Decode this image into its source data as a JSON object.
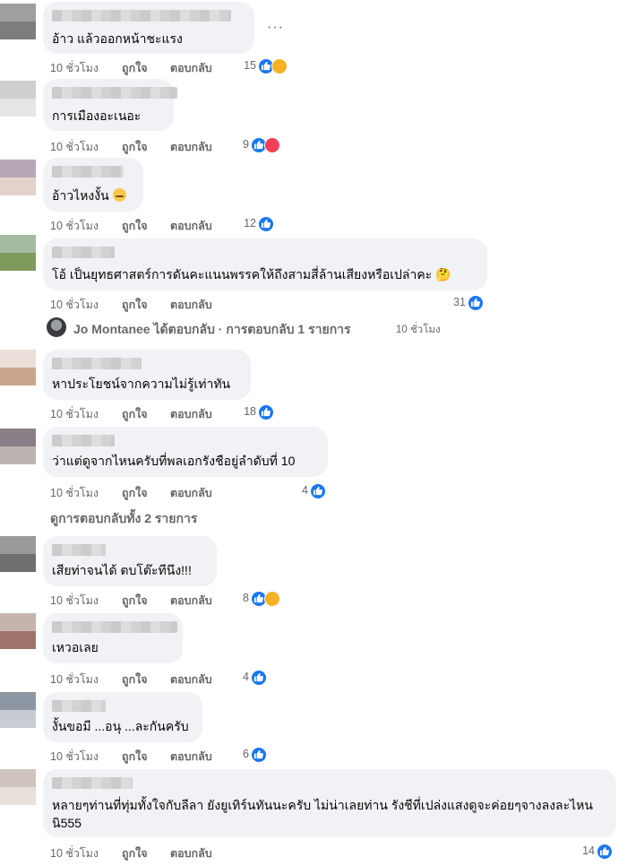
{
  "time_label": "10 ชั่วโมง",
  "like_label": "ถูกใจ",
  "reply_label": "ตอบกลับ",
  "more_icon": "···",
  "reply_summary": {
    "text": "Jo Montanee ได้ตอบกลับ · การตอบกลับ 1 รายการ",
    "time": "10 ชั่วโมง"
  },
  "view_all_replies": "ดูการตอบกลับทั้ง 2 รายการ",
  "colors": {
    "bubble": "#f0f2f5",
    "meta": "#65676b",
    "like_blue": "#1877f2",
    "haha": "#f7b125",
    "love": "#f33e58"
  },
  "comments": [
    {
      "text": "อ้าว แล้วออกหน้าชะแรง",
      "reactions": "15",
      "icons": [
        "like-icon",
        "haha-icon"
      ]
    },
    {
      "text": "การเมืองอะเนอะ",
      "reactions": "9",
      "icons": [
        "like-icon",
        "love-icon"
      ]
    },
    {
      "text": "อ้าวไหงงั้น",
      "emoji": "confused-face-emoji",
      "reactions": "12",
      "icons": [
        "like-icon"
      ]
    },
    {
      "text": "โอ้ เป็นยุทธศาสตร์การดันคะแนนพรรคให้ถึงสามสี่ล้านเสียงหรือเปล่าคะ 🤔",
      "reactions": "31",
      "icons": [
        "like-icon"
      ]
    },
    {
      "text": "หาประโยชน์จากความไม่รู้เท่าทัน",
      "reactions": "18",
      "icons": [
        "like-icon"
      ]
    },
    {
      "text": "ว่าแต่ดูจากไหนครับที่พลเอกรังชือยู่ลำดับที่ 10",
      "reactions": "4",
      "icons": [
        "like-icon"
      ]
    },
    {
      "text": "เสียท่าจนได้ ตบโต๊ะทีนึง!!!",
      "reactions": "8",
      "icons": [
        "like-icon",
        "haha-icon"
      ]
    },
    {
      "text": "เหวอเลย",
      "reactions": "4",
      "icons": [
        "like-icon"
      ]
    },
    {
      "text": "งั้นขอมี ...อนุ ...ละกันครับ",
      "reactions": "6",
      "icons": [
        "like-icon"
      ]
    },
    {
      "text": "หลายๆท่านที่ทุ่มทั้งใจกับลีลา ยังยูเทิร์นทันนะครับ ไม่น่าเลยท่าน รังชีที่เปล่งแสงดูจะค่อยๆจางลงละไหนนิ555",
      "reactions": "14",
      "icons": [
        "like-icon"
      ]
    }
  ]
}
